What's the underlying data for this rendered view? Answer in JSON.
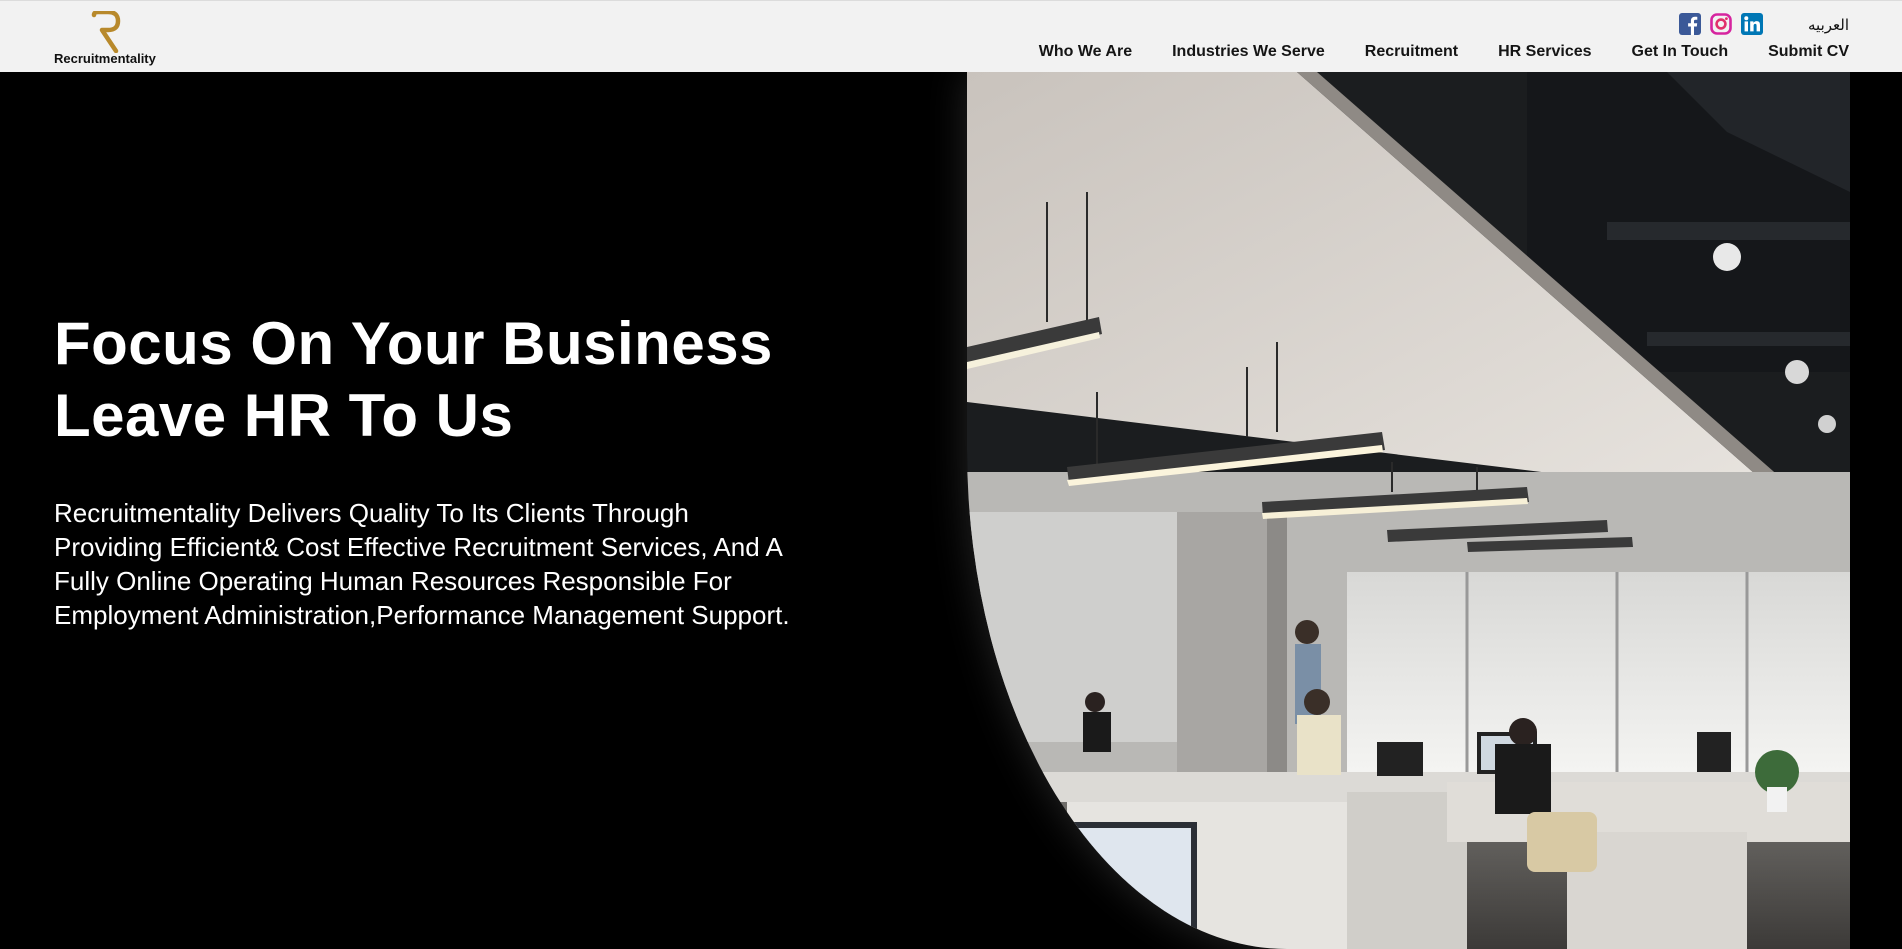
{
  "brand": {
    "name": "Recruitmentality",
    "accent": "#b8892b"
  },
  "header": {
    "language_link": "العربيه",
    "social": [
      {
        "icon": "facebook-icon",
        "color": "#3b5998"
      },
      {
        "icon": "instagram-icon",
        "color": "#d6249f"
      },
      {
        "icon": "linkedin-icon",
        "color": "#0077b5"
      }
    ],
    "nav": [
      {
        "label": "Who We Are"
      },
      {
        "label": "Industries We Serve"
      },
      {
        "label": "Recruitment"
      },
      {
        "label": "HR Services"
      },
      {
        "label": "Get In Touch"
      },
      {
        "label": "Submit CV"
      }
    ]
  },
  "hero": {
    "headline_line1": "Focus On Your Business",
    "headline_line2": "Leave HR To Us",
    "tagline": "Recruitmentality Delivers Quality To Its Clients Through Providing Efficient& Cost Effective Recruitment Services, And A Fully Online Operating Human Resources Responsible For Employment Administration,Performance Management Support.",
    "image_subject": "office-photo"
  }
}
